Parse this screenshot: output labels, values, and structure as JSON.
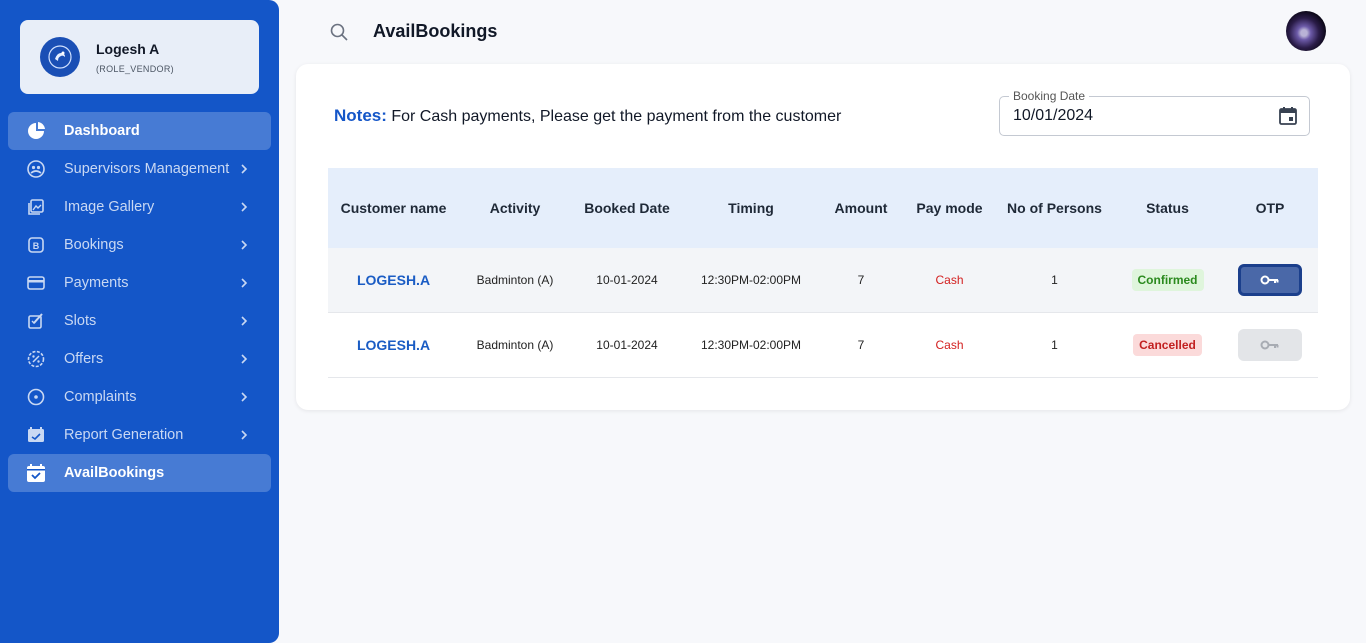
{
  "profile": {
    "name": "Logesh A",
    "role": "(ROLE_VENDOR)"
  },
  "sidebar": {
    "items": [
      {
        "label": "Dashboard",
        "icon": "pie-chart-icon",
        "active": true,
        "chevron": false
      },
      {
        "label": "Supervisors Management",
        "icon": "supervisor-icon",
        "active": false,
        "chevron": true
      },
      {
        "label": "Image Gallery",
        "icon": "image-gallery-icon",
        "active": false,
        "chevron": true
      },
      {
        "label": "Bookings",
        "icon": "bookings-icon",
        "active": false,
        "chevron": true
      },
      {
        "label": "Payments",
        "icon": "credit-card-icon",
        "active": false,
        "chevron": true
      },
      {
        "label": "Slots",
        "icon": "slots-icon",
        "active": false,
        "chevron": true
      },
      {
        "label": "Offers",
        "icon": "offers-icon",
        "active": false,
        "chevron": true
      },
      {
        "label": "Complaints",
        "icon": "complaints-icon",
        "active": false,
        "chevron": true
      },
      {
        "label": "Report Generation",
        "icon": "report-icon",
        "active": false,
        "chevron": true
      },
      {
        "label": "AvailBookings",
        "icon": "calendar-check-icon",
        "active": true,
        "chevron": false
      }
    ]
  },
  "header": {
    "title": "AvailBookings"
  },
  "notes": {
    "label": "Notes:",
    "text": " For Cash payments, Please get the payment from the customer"
  },
  "date_field": {
    "label": "Booking Date",
    "value": "10/01/2024"
  },
  "table": {
    "headers": [
      "Customer name",
      "Activity",
      "Booked Date",
      "Timing",
      "Amount",
      "Pay mode",
      "No of Persons",
      "Status",
      "OTP"
    ],
    "rows": [
      {
        "customer": "LOGESH.A",
        "activity": "Badminton (A)",
        "date": "10-01-2024",
        "timing": "12:30PM-02:00PM",
        "amount": "7",
        "paymode": "Cash",
        "persons": "1",
        "status": "Confirmed",
        "otp_enabled": true
      },
      {
        "customer": "LOGESH.A",
        "activity": "Badminton (A)",
        "date": "10-01-2024",
        "timing": "12:30PM-02:00PM",
        "amount": "7",
        "paymode": "Cash",
        "persons": "1",
        "status": "Cancelled",
        "otp_enabled": false
      }
    ]
  },
  "colors": {
    "sidebar": "#1456c8",
    "accent": "#1456c8",
    "confirmed": "#2b8a1e",
    "cancelled": "#c22020",
    "cash": "#d32020"
  }
}
